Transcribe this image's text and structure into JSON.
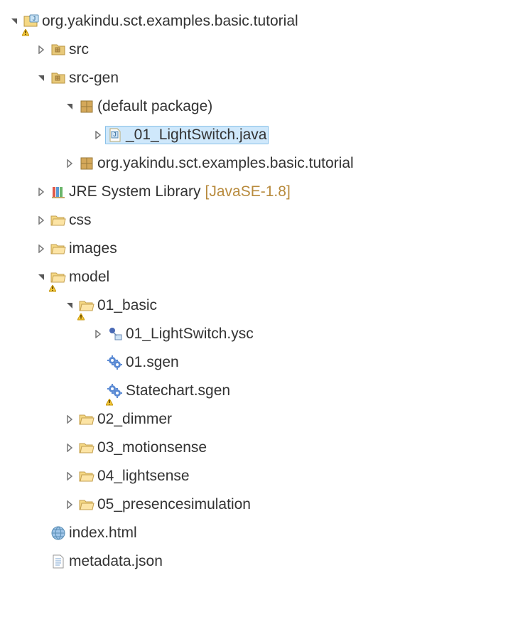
{
  "tree": {
    "project": {
      "label": "org.yakindu.sct.examples.basic.tutorial",
      "src": {
        "label": "src"
      },
      "srcgen": {
        "label": "src-gen",
        "defaultpkg": {
          "label": "(default package)",
          "lightswitch": {
            "label": "_01_LightSwitch.java"
          }
        },
        "pkg": {
          "label": "org.yakindu.sct.examples.basic.tutorial"
        }
      },
      "jre": {
        "label": "JRE System Library",
        "decorator": "[JavaSE-1.8]"
      },
      "css": {
        "label": "css"
      },
      "images": {
        "label": "images"
      },
      "model": {
        "label": "model",
        "basic": {
          "label": "01_basic",
          "ysc": {
            "label": "01_LightSwitch.ysc"
          },
          "sgen01": {
            "label": "01.sgen"
          },
          "sgenstate": {
            "label": "Statechart.sgen"
          }
        },
        "dimmer": {
          "label": "02_dimmer"
        },
        "motion": {
          "label": "03_motionsense"
        },
        "light": {
          "label": "04_lightsense"
        },
        "presence": {
          "label": "05_presencesimulation"
        }
      },
      "index": {
        "label": "index.html"
      },
      "metadata": {
        "label": "metadata.json"
      }
    }
  }
}
